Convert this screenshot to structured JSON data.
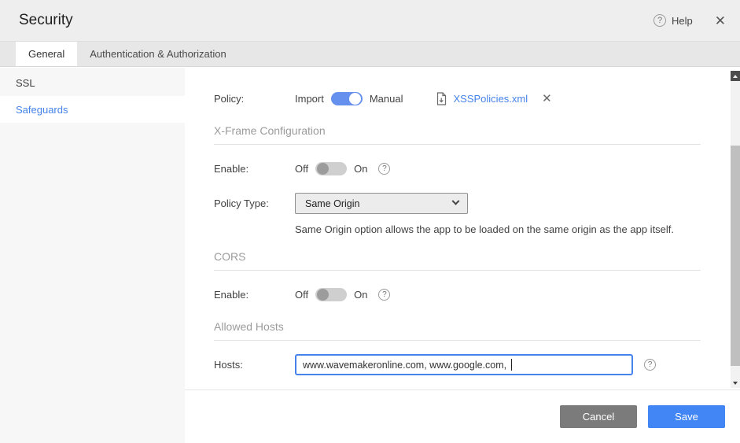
{
  "header": {
    "title": "Security",
    "help": "Help",
    "help_icon": "?",
    "close_icon": "✕"
  },
  "tabs": [
    {
      "label": "General",
      "active": true
    },
    {
      "label": "Authentication & Authorization",
      "active": false
    }
  ],
  "sidebar": [
    {
      "label": "SSL",
      "active": false
    },
    {
      "label": "Safeguards",
      "active": true
    }
  ],
  "form": {
    "policy": {
      "label": "Policy:",
      "option_left": "Import",
      "option_right": "Manual",
      "file_name": "XSSPolicies.xml",
      "remove_icon": "✕"
    },
    "xframe": {
      "heading": "X-Frame Configuration",
      "enable_label": "Enable:",
      "off": "Off",
      "on": "On",
      "help_icon": "?",
      "policy_type_label": "Policy Type:",
      "policy_type_value": "Same Origin",
      "description": "Same Origin option allows the app to be loaded on the same origin as the app itself."
    },
    "cors": {
      "heading": "CORS",
      "enable_label": "Enable:",
      "off": "Off",
      "on": "On",
      "help_icon": "?"
    },
    "allowed_hosts": {
      "heading": "Allowed Hosts",
      "hosts_label": "Hosts:",
      "hosts_value": "www.wavemakeronline.com, www.google.com, ",
      "help_icon": "?"
    }
  },
  "footer": {
    "cancel": "Cancel",
    "save": "Save"
  },
  "colors": {
    "accent": "#4285f4",
    "link": "#4683ea",
    "toggle_on": "#6690ee",
    "cancel_button": "#7b7b7b",
    "heading_gray": "#9b9b9b"
  }
}
